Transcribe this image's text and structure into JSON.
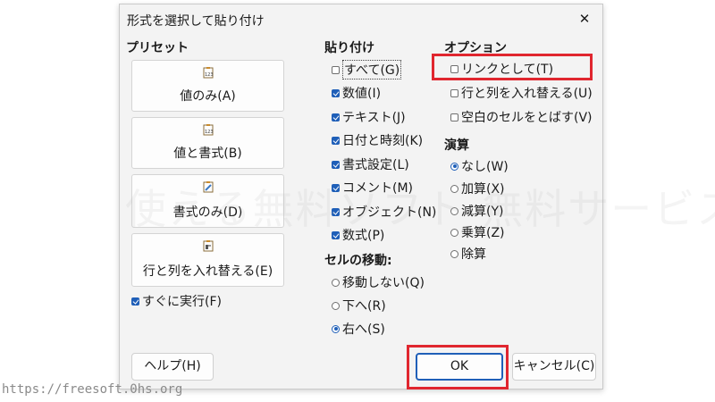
{
  "dialog": {
    "title": "形式を選択して貼り付け"
  },
  "presets": {
    "heading": "プリセット",
    "buttons": [
      {
        "label": "値のみ(A)",
        "icon": "clipboard-123-icon"
      },
      {
        "label": "値と書式(B)",
        "icon": "clipboard-123-icon"
      },
      {
        "label": "書式のみ(D)",
        "icon": "clipboard-brush-icon"
      },
      {
        "label": "行と列を入れ替える(E)",
        "icon": "clipboard-transpose-icon"
      }
    ],
    "run_immediately": {
      "label": "すぐに実行(F)",
      "checked": true
    }
  },
  "paste": {
    "heading": "貼り付け",
    "items": [
      {
        "label": "すべて(G)",
        "checked": false
      },
      {
        "label": "数値(I)",
        "checked": true
      },
      {
        "label": "テキスト(J)",
        "checked": true
      },
      {
        "label": "日付と時刻(K)",
        "checked": true
      },
      {
        "label": "書式設定(L)",
        "checked": true
      },
      {
        "label": "コメント(M)",
        "checked": true
      },
      {
        "label": "オブジェクト(N)",
        "checked": true
      },
      {
        "label": "数式(P)",
        "checked": true
      }
    ]
  },
  "cell_move": {
    "heading": "セルの移動:",
    "items": [
      {
        "label": "移動しない(Q)",
        "selected": false
      },
      {
        "label": "下へ(R)",
        "selected": false
      },
      {
        "label": "右へ(S)",
        "selected": true
      }
    ]
  },
  "options": {
    "heading": "オプション",
    "items": [
      {
        "label": "リンクとして(T)",
        "checked": false
      },
      {
        "label": "行と列を入れ替える(U)",
        "checked": false
      },
      {
        "label": "空白のセルをとばす(V)",
        "checked": false
      }
    ]
  },
  "operation": {
    "heading": "演算",
    "items": [
      {
        "label": "なし(W)",
        "selected": true
      },
      {
        "label": "加算(X)",
        "selected": false
      },
      {
        "label": "減算(Y)",
        "selected": false
      },
      {
        "label": "乗算(Z)",
        "selected": false
      },
      {
        "label": "除算",
        "selected": false
      }
    ]
  },
  "buttons": {
    "help": "ヘルプ(H)",
    "ok": "OK",
    "cancel": "キャンセル(C)"
  },
  "watermark": "使える無料ソフト 無料サービス",
  "footer_url": "https://freesoft.0hs.org",
  "colors": {
    "accent": "#1f5fb8",
    "highlight": "#e0262f"
  }
}
